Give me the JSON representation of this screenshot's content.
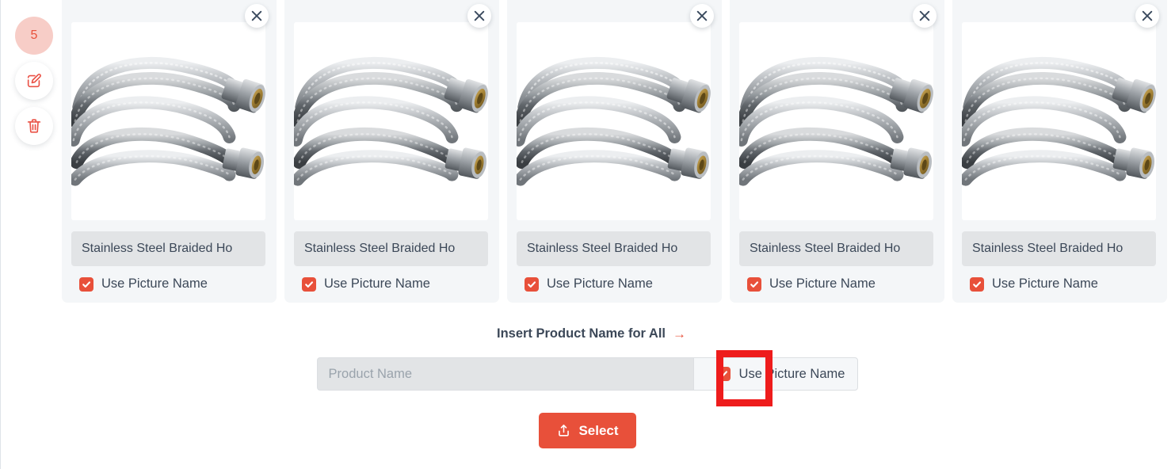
{
  "rail": {
    "count": "5",
    "count_name": "selected-count-badge",
    "edit_icon": "edit-pencil-icon",
    "delete_icon": "trash-icon"
  },
  "cards": [
    {
      "name_value": "Stainless Steel Braided Ho",
      "use_picture_name_label": "Use Picture Name",
      "checked": true,
      "close_icon": "close-icon",
      "image_alt": "stainless-steel-braided-hose"
    },
    {
      "name_value": "Stainless Steel Braided Ho",
      "use_picture_name_label": "Use Picture Name",
      "checked": true,
      "close_icon": "close-icon",
      "image_alt": "stainless-steel-braided-hose"
    },
    {
      "name_value": "Stainless Steel Braided Ho",
      "use_picture_name_label": "Use Picture Name",
      "checked": true,
      "close_icon": "close-icon",
      "image_alt": "stainless-steel-braided-hose"
    },
    {
      "name_value": "Stainless Steel Braided Ho",
      "use_picture_name_label": "Use Picture Name",
      "checked": true,
      "close_icon": "close-icon",
      "image_alt": "stainless-steel-braided-hose"
    },
    {
      "name_value": "Stainless Steel Braided Ho",
      "use_picture_name_label": "Use Picture Name",
      "checked": true,
      "close_icon": "close-icon",
      "image_alt": "stainless-steel-braided-hose"
    }
  ],
  "bulk": {
    "title": "Insert Product Name for All",
    "arrow": "→",
    "input_placeholder": "Product Name",
    "input_value": "",
    "use_picture_name_label": "Use Picture Name",
    "checked": true
  },
  "select_button": {
    "label": "Select",
    "icon": "upload-icon"
  },
  "colors": {
    "accent": "#e8503a",
    "annotation": "#ee1c1c",
    "card_bg": "#f4f6f8",
    "input_bg": "#e2e4e6",
    "text": "#3c4858"
  }
}
